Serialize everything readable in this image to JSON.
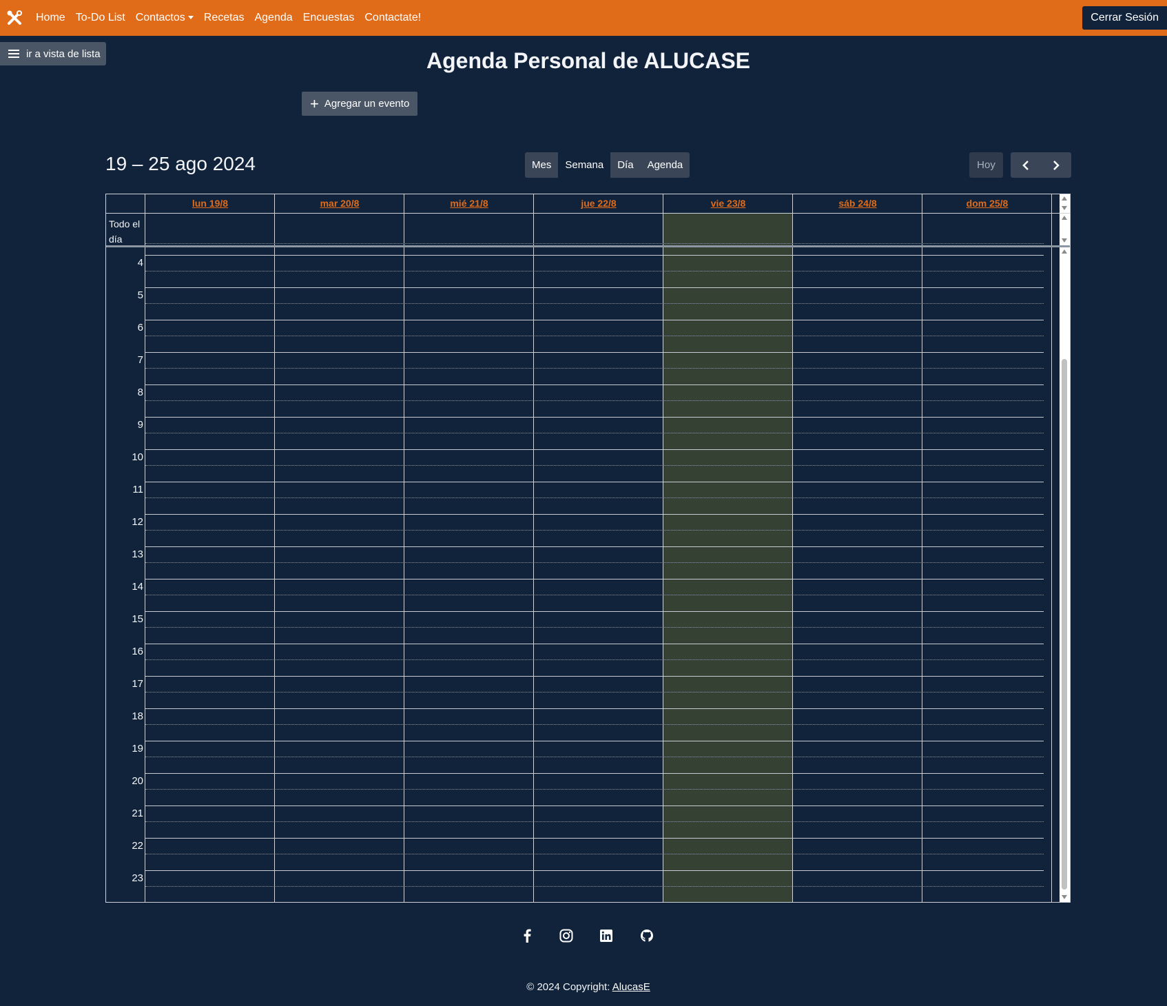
{
  "navbar": {
    "links": [
      "Home",
      "To-Do List",
      "Contactos",
      "Recetas",
      "Agenda",
      "Encuestas",
      "Contactate!"
    ],
    "logout_label": "Cerrar Sesión"
  },
  "sidebar_toggle_label": "ir a vista de lista",
  "page_title": "Agenda Personal de ALUCASE",
  "add_event_label": "Agregar un evento",
  "calendar": {
    "range_label": "19 – 25 ago 2024",
    "views": [
      "Mes",
      "Semana",
      "Día",
      "Agenda"
    ],
    "active_view": "Semana",
    "today_label": "Hoy",
    "days": [
      "lun 19/8",
      "mar 20/8",
      "mié 21/8",
      "jue 22/8",
      "vie 23/8",
      "sáb 24/8",
      "dom 25/8"
    ],
    "today_index": 4,
    "today_color": "#354233",
    "allday_label": "Todo el día",
    "hours": [
      "4",
      "5",
      "6",
      "7",
      "8",
      "9",
      "10",
      "11",
      "12",
      "13",
      "14",
      "15",
      "16",
      "17",
      "18",
      "19",
      "20",
      "21",
      "22",
      "23"
    ]
  },
  "footer": {
    "social_icons": [
      "facebook-icon",
      "instagram-icon",
      "linkedin-icon",
      "github-icon"
    ],
    "copyright_prefix": "© 2024 Copyright: ",
    "copyright_link": "AlucasE"
  },
  "colors": {
    "accent": "#e06c1a",
    "background": "#11233a",
    "button": "#4a5566"
  }
}
